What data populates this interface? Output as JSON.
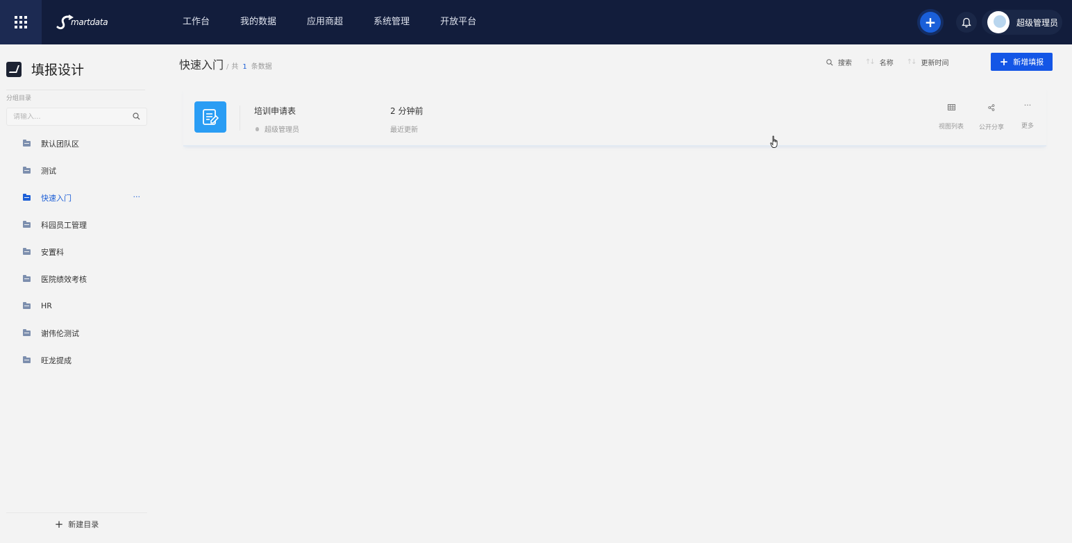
{
  "topbar": {
    "logo_text": "martdata",
    "nav": [
      "工作台",
      "我的数据",
      "应用商超",
      "系统管理",
      "开放平台"
    ],
    "user_name": "超级管理员",
    "plus_symbol": "+"
  },
  "sidebar": {
    "title": "填报设计",
    "section_label": "分组目录",
    "search_placeholder": "请输入...",
    "items": [
      {
        "label": "默认团队区",
        "active": false
      },
      {
        "label": "测试",
        "active": false
      },
      {
        "label": "快速入门",
        "active": true
      },
      {
        "label": "科园员工管理",
        "active": false
      },
      {
        "label": "安置科",
        "active": false
      },
      {
        "label": "医院绩效考核",
        "active": false
      },
      {
        "label": "HR",
        "active": false
      },
      {
        "label": "谢伟伦测试",
        "active": false
      },
      {
        "label": "旺龙提成",
        "active": false
      }
    ],
    "active_more": "···",
    "new_dir_label": "新建目录",
    "new_dir_symbol": "+"
  },
  "main": {
    "breadcrumb_title": "快速入门",
    "breadcrumb_sep": "/",
    "count_prefix": "共",
    "count": "1",
    "count_suffix": "条数据",
    "toolbar": {
      "search": "搜索",
      "sort_name": "名称",
      "sort_time": "更新时间",
      "sort_symbol": "↑↓"
    },
    "new_button": "新增填报",
    "new_button_symbol": "+"
  },
  "card": {
    "name": "培训申请表",
    "owner": "超级管理员",
    "time": "2 分钟前",
    "time_label": "最近更新",
    "actions": {
      "view_list": "视图列表",
      "share": "公开分享",
      "more": "更多",
      "more_symbol": "···"
    }
  },
  "colors": {
    "topbar": "#121d3c",
    "accent": "#1456e6",
    "active_item": "#1d5fd6",
    "card_icon": "#2a9df4"
  },
  "icons": {
    "apps": "grid-icon",
    "bell": "bell-icon",
    "search": "search-icon",
    "folder": "folder-icon",
    "form": "form-edit-icon",
    "table": "table-icon",
    "share": "share-icon"
  }
}
